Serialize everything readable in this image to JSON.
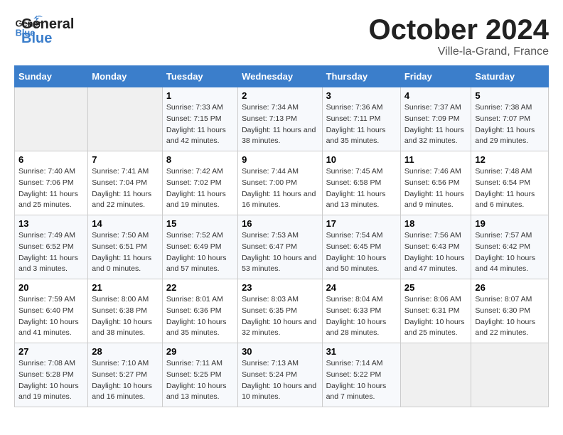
{
  "header": {
    "logo_general": "General",
    "logo_blue": "Blue",
    "month_title": "October 2024",
    "subtitle": "Ville-la-Grand, France"
  },
  "days_of_week": [
    "Sunday",
    "Monday",
    "Tuesday",
    "Wednesday",
    "Thursday",
    "Friday",
    "Saturday"
  ],
  "weeks": [
    [
      {
        "day": "",
        "sunrise": "",
        "sunset": "",
        "daylight": "",
        "empty": true
      },
      {
        "day": "",
        "sunrise": "",
        "sunset": "",
        "daylight": "",
        "empty": true
      },
      {
        "day": "1",
        "sunrise": "Sunrise: 7:33 AM",
        "sunset": "Sunset: 7:15 PM",
        "daylight": "Daylight: 11 hours and 42 minutes.",
        "empty": false
      },
      {
        "day": "2",
        "sunrise": "Sunrise: 7:34 AM",
        "sunset": "Sunset: 7:13 PM",
        "daylight": "Daylight: 11 hours and 38 minutes.",
        "empty": false
      },
      {
        "day": "3",
        "sunrise": "Sunrise: 7:36 AM",
        "sunset": "Sunset: 7:11 PM",
        "daylight": "Daylight: 11 hours and 35 minutes.",
        "empty": false
      },
      {
        "day": "4",
        "sunrise": "Sunrise: 7:37 AM",
        "sunset": "Sunset: 7:09 PM",
        "daylight": "Daylight: 11 hours and 32 minutes.",
        "empty": false
      },
      {
        "day": "5",
        "sunrise": "Sunrise: 7:38 AM",
        "sunset": "Sunset: 7:07 PM",
        "daylight": "Daylight: 11 hours and 29 minutes.",
        "empty": false
      }
    ],
    [
      {
        "day": "6",
        "sunrise": "Sunrise: 7:40 AM",
        "sunset": "Sunset: 7:06 PM",
        "daylight": "Daylight: 11 hours and 25 minutes.",
        "empty": false
      },
      {
        "day": "7",
        "sunrise": "Sunrise: 7:41 AM",
        "sunset": "Sunset: 7:04 PM",
        "daylight": "Daylight: 11 hours and 22 minutes.",
        "empty": false
      },
      {
        "day": "8",
        "sunrise": "Sunrise: 7:42 AM",
        "sunset": "Sunset: 7:02 PM",
        "daylight": "Daylight: 11 hours and 19 minutes.",
        "empty": false
      },
      {
        "day": "9",
        "sunrise": "Sunrise: 7:44 AM",
        "sunset": "Sunset: 7:00 PM",
        "daylight": "Daylight: 11 hours and 16 minutes.",
        "empty": false
      },
      {
        "day": "10",
        "sunrise": "Sunrise: 7:45 AM",
        "sunset": "Sunset: 6:58 PM",
        "daylight": "Daylight: 11 hours and 13 minutes.",
        "empty": false
      },
      {
        "day": "11",
        "sunrise": "Sunrise: 7:46 AM",
        "sunset": "Sunset: 6:56 PM",
        "daylight": "Daylight: 11 hours and 9 minutes.",
        "empty": false
      },
      {
        "day": "12",
        "sunrise": "Sunrise: 7:48 AM",
        "sunset": "Sunset: 6:54 PM",
        "daylight": "Daylight: 11 hours and 6 minutes.",
        "empty": false
      }
    ],
    [
      {
        "day": "13",
        "sunrise": "Sunrise: 7:49 AM",
        "sunset": "Sunset: 6:52 PM",
        "daylight": "Daylight: 11 hours and 3 minutes.",
        "empty": false
      },
      {
        "day": "14",
        "sunrise": "Sunrise: 7:50 AM",
        "sunset": "Sunset: 6:51 PM",
        "daylight": "Daylight: 11 hours and 0 minutes.",
        "empty": false
      },
      {
        "day": "15",
        "sunrise": "Sunrise: 7:52 AM",
        "sunset": "Sunset: 6:49 PM",
        "daylight": "Daylight: 10 hours and 57 minutes.",
        "empty": false
      },
      {
        "day": "16",
        "sunrise": "Sunrise: 7:53 AM",
        "sunset": "Sunset: 6:47 PM",
        "daylight": "Daylight: 10 hours and 53 minutes.",
        "empty": false
      },
      {
        "day": "17",
        "sunrise": "Sunrise: 7:54 AM",
        "sunset": "Sunset: 6:45 PM",
        "daylight": "Daylight: 10 hours and 50 minutes.",
        "empty": false
      },
      {
        "day": "18",
        "sunrise": "Sunrise: 7:56 AM",
        "sunset": "Sunset: 6:43 PM",
        "daylight": "Daylight: 10 hours and 47 minutes.",
        "empty": false
      },
      {
        "day": "19",
        "sunrise": "Sunrise: 7:57 AM",
        "sunset": "Sunset: 6:42 PM",
        "daylight": "Daylight: 10 hours and 44 minutes.",
        "empty": false
      }
    ],
    [
      {
        "day": "20",
        "sunrise": "Sunrise: 7:59 AM",
        "sunset": "Sunset: 6:40 PM",
        "daylight": "Daylight: 10 hours and 41 minutes.",
        "empty": false
      },
      {
        "day": "21",
        "sunrise": "Sunrise: 8:00 AM",
        "sunset": "Sunset: 6:38 PM",
        "daylight": "Daylight: 10 hours and 38 minutes.",
        "empty": false
      },
      {
        "day": "22",
        "sunrise": "Sunrise: 8:01 AM",
        "sunset": "Sunset: 6:36 PM",
        "daylight": "Daylight: 10 hours and 35 minutes.",
        "empty": false
      },
      {
        "day": "23",
        "sunrise": "Sunrise: 8:03 AM",
        "sunset": "Sunset: 6:35 PM",
        "daylight": "Daylight: 10 hours and 32 minutes.",
        "empty": false
      },
      {
        "day": "24",
        "sunrise": "Sunrise: 8:04 AM",
        "sunset": "Sunset: 6:33 PM",
        "daylight": "Daylight: 10 hours and 28 minutes.",
        "empty": false
      },
      {
        "day": "25",
        "sunrise": "Sunrise: 8:06 AM",
        "sunset": "Sunset: 6:31 PM",
        "daylight": "Daylight: 10 hours and 25 minutes.",
        "empty": false
      },
      {
        "day": "26",
        "sunrise": "Sunrise: 8:07 AM",
        "sunset": "Sunset: 6:30 PM",
        "daylight": "Daylight: 10 hours and 22 minutes.",
        "empty": false
      }
    ],
    [
      {
        "day": "27",
        "sunrise": "Sunrise: 7:08 AM",
        "sunset": "Sunset: 5:28 PM",
        "daylight": "Daylight: 10 hours and 19 minutes.",
        "empty": false
      },
      {
        "day": "28",
        "sunrise": "Sunrise: 7:10 AM",
        "sunset": "Sunset: 5:27 PM",
        "daylight": "Daylight: 10 hours and 16 minutes.",
        "empty": false
      },
      {
        "day": "29",
        "sunrise": "Sunrise: 7:11 AM",
        "sunset": "Sunset: 5:25 PM",
        "daylight": "Daylight: 10 hours and 13 minutes.",
        "empty": false
      },
      {
        "day": "30",
        "sunrise": "Sunrise: 7:13 AM",
        "sunset": "Sunset: 5:24 PM",
        "daylight": "Daylight: 10 hours and 10 minutes.",
        "empty": false
      },
      {
        "day": "31",
        "sunrise": "Sunrise: 7:14 AM",
        "sunset": "Sunset: 5:22 PM",
        "daylight": "Daylight: 10 hours and 7 minutes.",
        "empty": false
      },
      {
        "day": "",
        "sunrise": "",
        "sunset": "",
        "daylight": "",
        "empty": true
      },
      {
        "day": "",
        "sunrise": "",
        "sunset": "",
        "daylight": "",
        "empty": true
      }
    ]
  ]
}
